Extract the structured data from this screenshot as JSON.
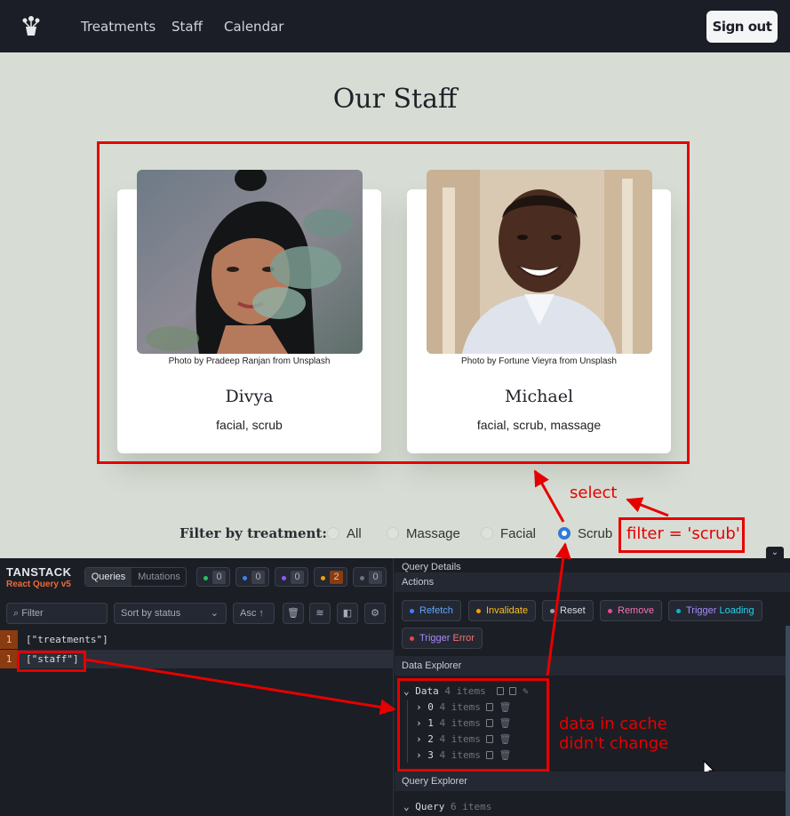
{
  "nav": {
    "links": [
      "Treatments",
      "Staff",
      "Calendar"
    ],
    "signout_label": "Sign out"
  },
  "page_title": "Our Staff",
  "staff": [
    {
      "credit": "Photo by Pradeep Ranjan from Unsplash",
      "name": "Divya",
      "treatments": "facial, scrub"
    },
    {
      "credit": "Photo by Fortune Vieyra from Unsplash",
      "name": "Michael",
      "treatments": "facial, scrub, massage"
    }
  ],
  "filter": {
    "label": "Filter by treatment:",
    "options": [
      "All",
      "Massage",
      "Facial",
      "Scrub"
    ],
    "selected": "Scrub"
  },
  "annotations": {
    "select": "select",
    "filter_value": "filter = 'scrub'",
    "cache_line1": "data in cache",
    "cache_line2": "didn't change"
  },
  "devtools": {
    "brand": "TANSTACK",
    "brand_sub": "React Query v5",
    "tabs": [
      "Queries",
      "Mutations"
    ],
    "status_counts": [
      {
        "color": "#22c55e",
        "count": "0"
      },
      {
        "color": "#3b82f6",
        "count": "0"
      },
      {
        "color": "#8b5cf6",
        "count": "0"
      },
      {
        "color": "#f59e0b",
        "count": "2"
      },
      {
        "color": "#6b7280",
        "count": "0"
      }
    ],
    "filter_placeholder": "Filter",
    "sort_label": "Sort by status",
    "order_label": "Asc ↑",
    "queries": [
      {
        "observers": "1",
        "key": "[\"treatments\"]"
      },
      {
        "observers": "1",
        "key": "[\"staff\"]"
      }
    ],
    "details": {
      "title": "Query Details",
      "actions_header": "Actions",
      "actions": [
        {
          "label": "Refetch",
          "color": "#3b82f6"
        },
        {
          "label": "Invalidate",
          "color": "#f59e0b"
        },
        {
          "label": "Reset",
          "color": "#9ca3af"
        },
        {
          "label": "Remove",
          "color": "#ec4899"
        },
        {
          "label": "Trigger",
          "extra": "Loading",
          "color": "#06b6d4"
        },
        {
          "label": "Trigger",
          "extra": "Error",
          "color": "#ef4444"
        }
      ],
      "data_header": "Data Explorer",
      "data_root": "Data",
      "data_root_count": "4 items",
      "data_items": [
        {
          "index": "0",
          "count": "4 items"
        },
        {
          "index": "1",
          "count": "4 items"
        },
        {
          "index": "2",
          "count": "4 items"
        },
        {
          "index": "3",
          "count": "4 items"
        }
      ],
      "query_header": "Query Explorer",
      "query_root": "Query",
      "query_root_count": "6 items"
    }
  }
}
